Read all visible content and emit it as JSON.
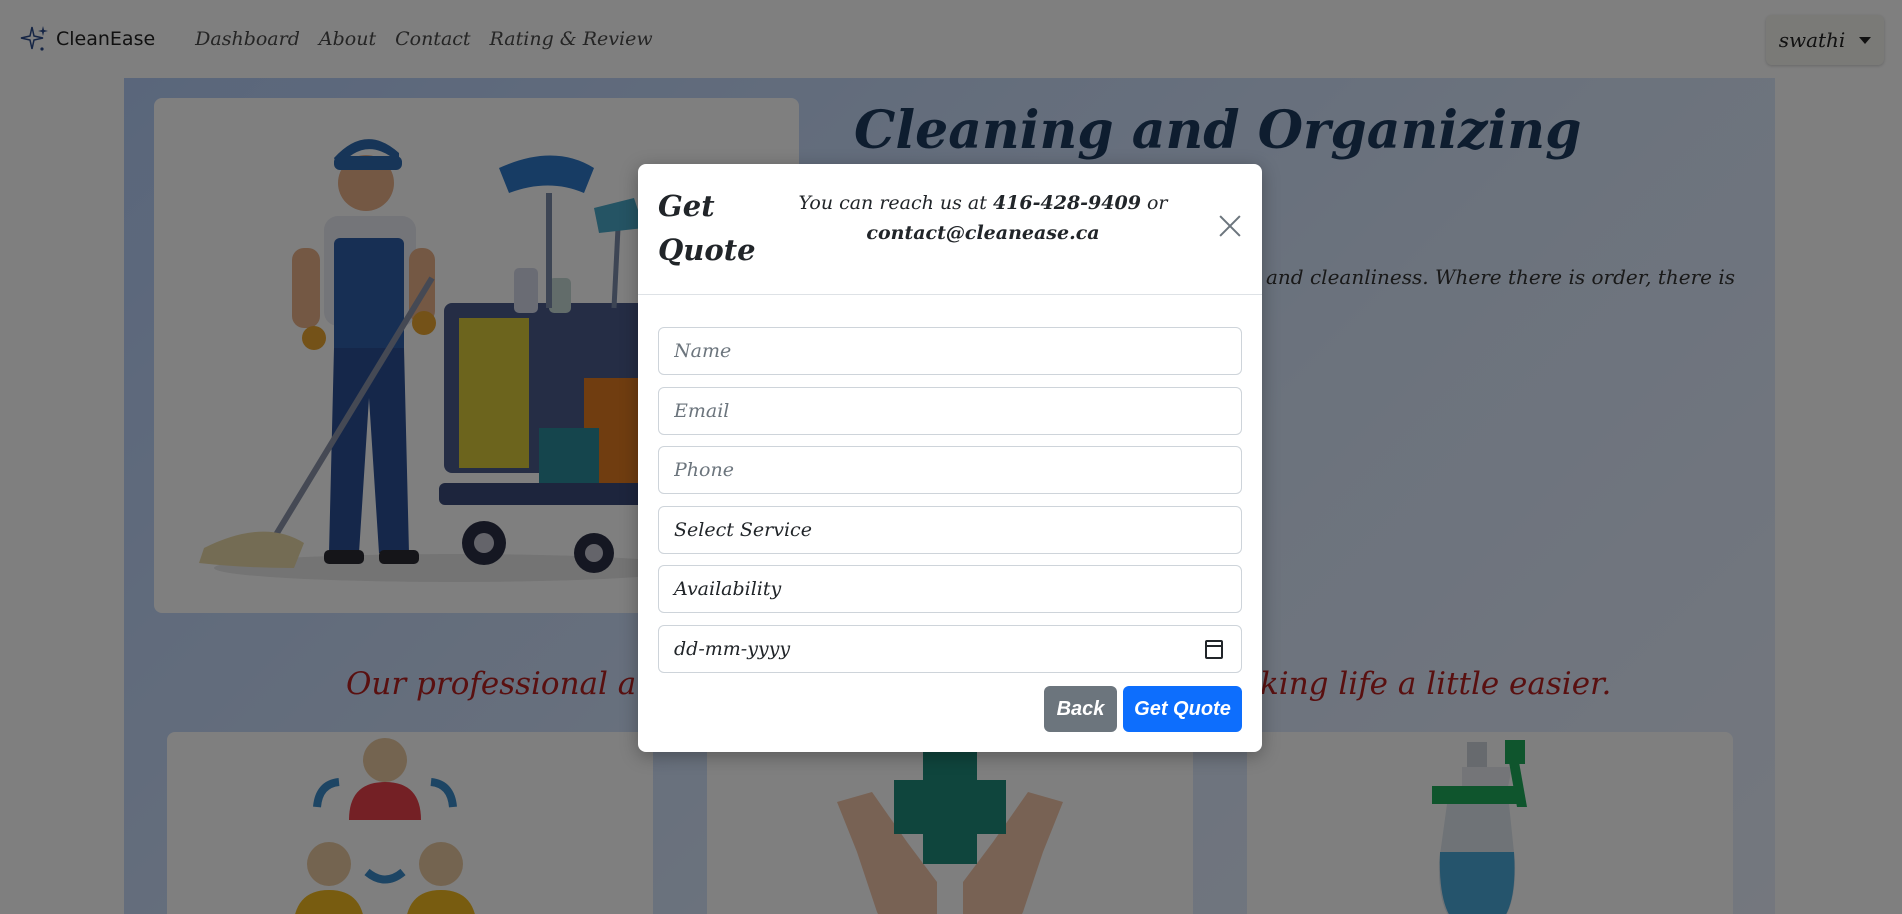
{
  "navbar": {
    "brand": "CleanEase",
    "links": [
      "Dashboard",
      "About",
      "Contact",
      "Rating & Review"
    ],
    "user": "swathi"
  },
  "hero": {
    "title": "Cleaning and Organizing",
    "text_visible": "and cleanliness. Where there is order, there is"
  },
  "tagline": "Our professional and e... king life a little easier.",
  "tagline_left": "Our professional and e",
  "tagline_right": "king life a little easier.",
  "modal": {
    "title": "Get Quote",
    "contact_prefix": "You can reach us at",
    "phone": "416-428-9409",
    "contact_or": "or",
    "email": "contact@cleanease.ca",
    "fields": {
      "name_placeholder": "Name",
      "email_placeholder": "Email",
      "phone_placeholder": "Phone",
      "service_value": "Select Service",
      "availability_value": "Availability",
      "date_value": "dd-mm-yyyy"
    },
    "back_label": "Back",
    "submit_label": "Get Quote"
  },
  "colors": {
    "primary": "#0d6efd",
    "secondary": "#6c757d",
    "title": "#1c3a5e",
    "tagline": "#b32020",
    "overlay": "rgba(0,0,0,0.5)"
  }
}
